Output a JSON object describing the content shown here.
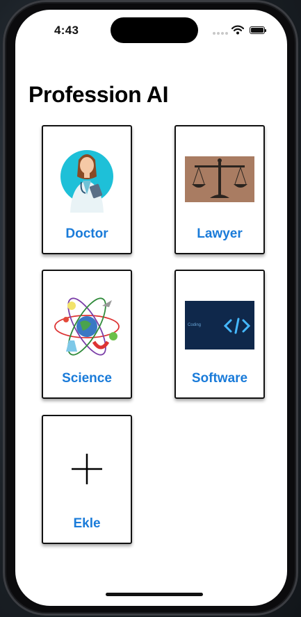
{
  "status_bar": {
    "time": "4:43"
  },
  "app": {
    "title": "Profession AI"
  },
  "cards": [
    {
      "label": "Doctor",
      "icon": "doctor-illustration-icon"
    },
    {
      "label": "Lawyer",
      "icon": "scales-of-justice-icon"
    },
    {
      "label": "Science",
      "icon": "atom-science-icon"
    },
    {
      "label": "Software",
      "icon": "code-brackets-icon",
      "art_text": "Coding"
    },
    {
      "label": "Ekle",
      "icon": "plus-icon"
    }
  ],
  "colors": {
    "label_blue": "#1a7bd9",
    "accent_cyan": "#1ec0d8"
  }
}
